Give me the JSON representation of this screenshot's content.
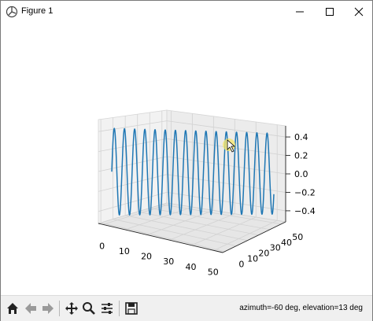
{
  "window": {
    "title": "Figure 1"
  },
  "controls": {
    "minimize": "minimize-icon",
    "maximize": "maximize-icon",
    "close": "close-icon"
  },
  "toolbar": {
    "buttons": [
      "home-icon",
      "back-icon",
      "forward-icon",
      "pan-icon",
      "zoom-icon",
      "configure-subplots-icon",
      "save-icon"
    ],
    "status": "azimuth=-60 deg, elevation=13 deg"
  },
  "chart_data": {
    "type": "line",
    "projection": "3d",
    "series": [
      {
        "function": "0.45*sin(z)",
        "z_range": [
          0,
          100
        ],
        "color": "#1f77b4"
      }
    ],
    "x_ticks": [
      "0",
      "10",
      "20",
      "30",
      "40",
      "50"
    ],
    "y_ticks": [
      "0",
      "10",
      "20",
      "30",
      "40",
      "50"
    ],
    "z_ticks": [
      "0.4",
      "0.2",
      "0.0",
      "−0.2",
      "−0.4"
    ],
    "z_values": [
      0.4,
      0.2,
      0.0,
      -0.2,
      -0.4
    ],
    "grid": true,
    "view": {
      "azimuth": -60,
      "elevation": 13
    }
  }
}
